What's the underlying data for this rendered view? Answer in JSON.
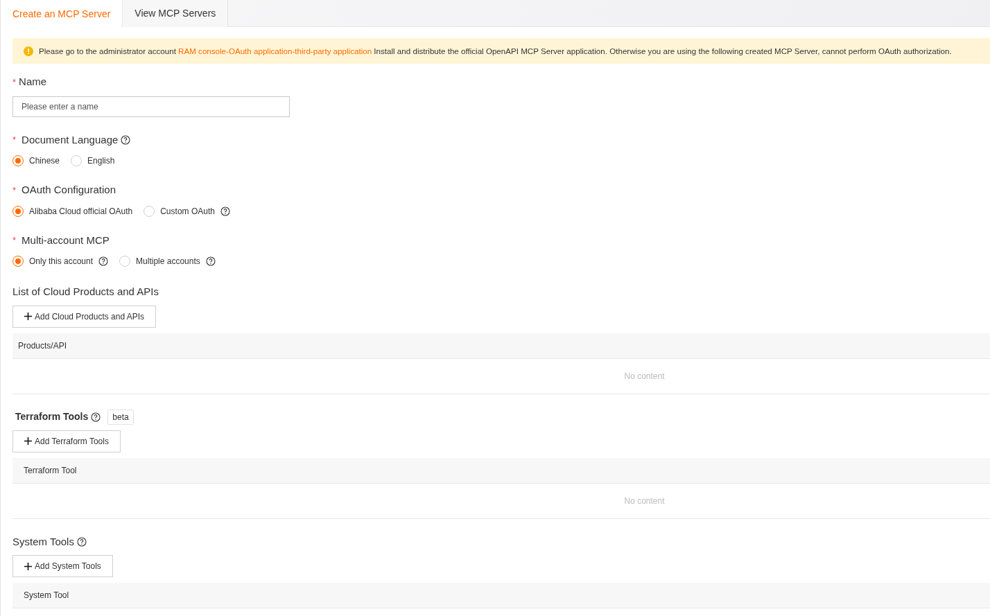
{
  "tabs": [
    {
      "label": "Create an MCP Server",
      "selected": true
    },
    {
      "label": "View MCP Servers",
      "selected": false
    }
  ],
  "notice": {
    "before": "Please go to the administrator account",
    "link": "RAM console-OAuth application-third-party application",
    "after": "Install and distribute the official OpenAPI MCP Server application. Otherwise you are using the following created MCP Server, cannot perform OAuth authorization."
  },
  "name_field": {
    "required_mark": "*",
    "label": "Name",
    "placeholder": "Please enter a name"
  },
  "radio_groups": [
    {
      "required_mark": "*",
      "label": "Document Language",
      "help": true,
      "options": [
        {
          "label": "Chinese",
          "selected": true,
          "help": false
        },
        {
          "label": "English",
          "selected": false,
          "help": false
        }
      ]
    },
    {
      "required_mark": "*",
      "label": "OAuth Configuration",
      "help": false,
      "options": [
        {
          "label": "Alibaba Cloud official OAuth",
          "selected": true,
          "help": false
        },
        {
          "label": "Custom OAuth",
          "selected": false,
          "help": true
        }
      ]
    },
    {
      "required_mark": "*",
      "label": "Multi-account MCP",
      "help": false,
      "options": [
        {
          "label": "Only this account",
          "selected": true,
          "help": true
        },
        {
          "label": "Multiple accounts",
          "selected": false,
          "help": true
        }
      ]
    }
  ],
  "sections": [
    {
      "title": "List of Cloud Products and APIs",
      "bold": false,
      "help": false,
      "button": "Add Cloud Products and APIs",
      "column": "Products/API",
      "empty": "No content"
    },
    {
      "title": "Terraform Tools",
      "bold": true,
      "help": true,
      "badge": "beta",
      "button": "Add Terraform Tools",
      "column": "Terraform Tool",
      "empty": "No content"
    },
    {
      "title": "System Tools",
      "bold": false,
      "help": true,
      "button": "Add System Tools",
      "column": "System Tool"
    }
  ]
}
